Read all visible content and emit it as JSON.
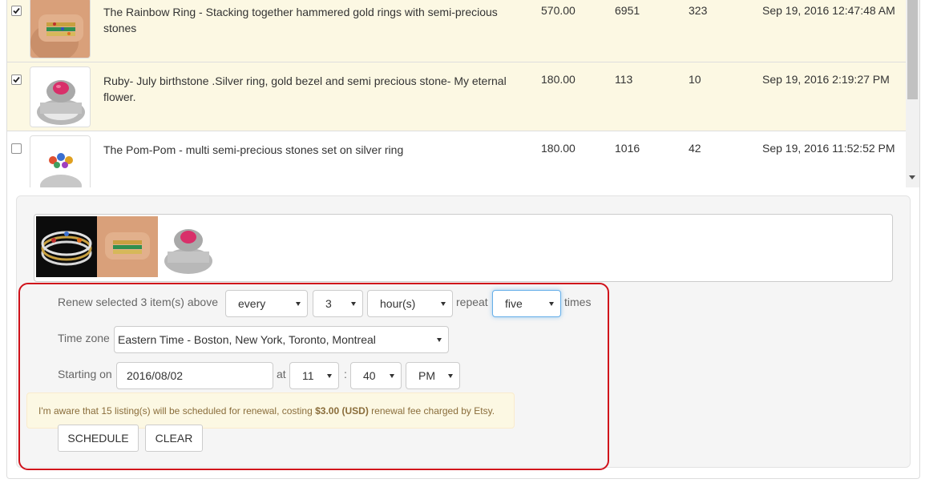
{
  "listings": [
    {
      "checked": true,
      "selected": true,
      "title": "The Rainbow Ring - Stacking together hammered gold rings with semi-precious stones",
      "price": "570.00",
      "views": "6951",
      "favorites": "323",
      "date": "Sep 19, 2016 12:47:48 AM",
      "thumb_icon": "rainbow-ring-photo"
    },
    {
      "checked": true,
      "selected": true,
      "title": "Ruby- July birthstone .Silver ring, gold bezel and semi precious stone- My eternal flower.",
      "price": "180.00",
      "views": "113",
      "favorites": "10",
      "date": "Sep 19, 2016 2:19:27 PM",
      "thumb_icon": "ruby-ring-photo"
    },
    {
      "checked": false,
      "selected": false,
      "title": "The Pom-Pom - multi semi-precious stones set on silver ring",
      "price": "180.00",
      "views": "1016",
      "favorites": "42",
      "date": "Sep 19, 2016 11:52:52 PM",
      "thumb_icon": "pom-pom-ring-photo"
    }
  ],
  "preview": {
    "thumbnails": [
      "stacked-rings-photo",
      "rainbow-ring-photo",
      "ruby-ring-photo"
    ]
  },
  "scheduler": {
    "renew_label": "Renew selected 3 item(s) above",
    "frequency_value": "every",
    "interval_value": "3",
    "unit_value": "hour(s)",
    "repeat_label": "repeat",
    "repeat_value": "five",
    "times_label": "times",
    "timezone_label": "Time zone",
    "timezone_value": "Eastern Time - Boston, New York, Toronto, Montreal",
    "starting_label": "Starting on",
    "start_date": "2016/08/02",
    "at_label": "at",
    "hour_value": "11",
    "colon": ":",
    "minute_value": "40",
    "ampm_value": "PM",
    "notice_prefix": "I'm aware that 15 listing(s) will be scheduled for renewal, costing ",
    "notice_amount": "$3.00 (USD)",
    "notice_suffix": " renewal fee charged by Etsy.",
    "schedule_button": "SCHEDULE",
    "clear_button": "CLEAR"
  },
  "colors": {
    "selected_row": "#fcf8e3",
    "highlight_border": "#d0121b",
    "notice_text": "#8a6d3b",
    "focus_border": "#66afe9"
  }
}
